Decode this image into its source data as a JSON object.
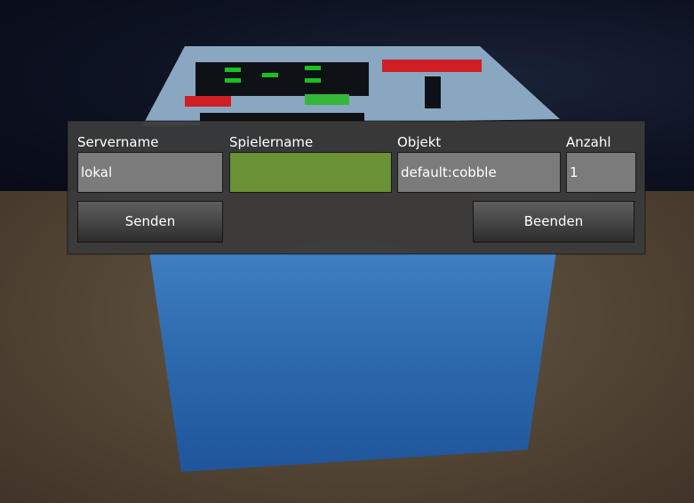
{
  "dialog": {
    "fields": {
      "servername": {
        "label": "Servername",
        "value": "lokal"
      },
      "spielername": {
        "label": "Spielername",
        "value": ""
      },
      "objekt": {
        "label": "Objekt",
        "value": "default:cobble"
      },
      "anzahl": {
        "label": "Anzahl",
        "value": "1"
      }
    },
    "buttons": {
      "send": "Senden",
      "quit": "Beenden"
    }
  },
  "colors": {
    "dialog_bg": "#3a3a3a",
    "field_gray": "#7b7b7b",
    "field_green": "#6a9136",
    "block_blue": "#2f6cb0"
  }
}
